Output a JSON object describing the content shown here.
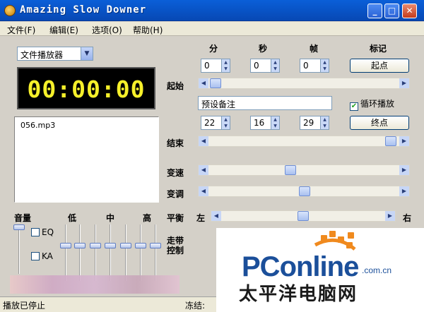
{
  "window": {
    "title": "Amazing Slow Downer"
  },
  "menu": [
    {
      "label": "文件(F)"
    },
    {
      "label": "编辑(E)"
    },
    {
      "label": "选项(O)"
    },
    {
      "label": "帮助(H)"
    }
  ],
  "player": {
    "selected": "文件播放器",
    "time": "00:00:00"
  },
  "files": [
    "056.mp3"
  ],
  "columns": {
    "min": "分",
    "sec": "秒",
    "frame": "帧",
    "mark": "标记"
  },
  "start": {
    "label": "起始",
    "min": "0",
    "sec": "0",
    "frame": "0",
    "button": "起点",
    "note": "预设备注",
    "loop_label": "循环播放",
    "loop_checked": true
  },
  "end": {
    "label": "结束",
    "min": "22",
    "sec": "16",
    "frame": "29",
    "button": "终点"
  },
  "rows": {
    "speed_label": "变速",
    "pitch_label": "变调",
    "balance_label": "平衡",
    "balance_left": "左",
    "balance_right": "右",
    "walk_label": "走带控制"
  },
  "mixer": {
    "volume": "音量",
    "low": "低",
    "mid": "中",
    "high": "高",
    "eq": "EQ",
    "ka": "KA"
  },
  "status": {
    "left": "播放已停止",
    "right": "冻结:"
  },
  "watermark": {
    "brand": "PConline",
    "domain": ".com.cn",
    "cn": "太平洋电脑网"
  }
}
